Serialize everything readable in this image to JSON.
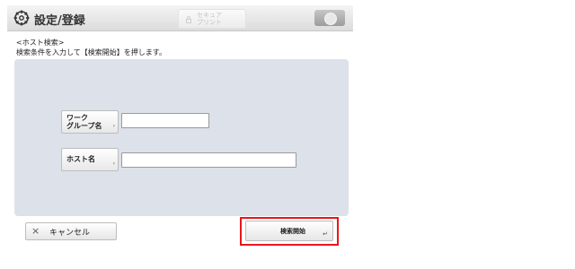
{
  "header": {
    "title": "設定/登録",
    "icon": "gear-icon",
    "secure_print": {
      "line1": "セキュア",
      "line2": "プリント",
      "icon": "lock-icon"
    },
    "status_monitor": {
      "icon": "status-monitor-icon"
    }
  },
  "heading": {
    "title": "<ホスト検索>",
    "instruction": "検索条件を入力して【検索開始】を押します。"
  },
  "fields": [
    {
      "label_line1": "ワーク",
      "label_line2": "グループ名",
      "arrow": "›",
      "value": ""
    },
    {
      "label_line1": "ホスト名",
      "label_line2": "",
      "arrow": "›",
      "value": ""
    }
  ],
  "footer": {
    "cancel": {
      "icon": "×",
      "label": "キャンセル"
    },
    "search": {
      "label": "検索開始",
      "arrow": "↵",
      "highlight_color": "#e8161b"
    }
  }
}
